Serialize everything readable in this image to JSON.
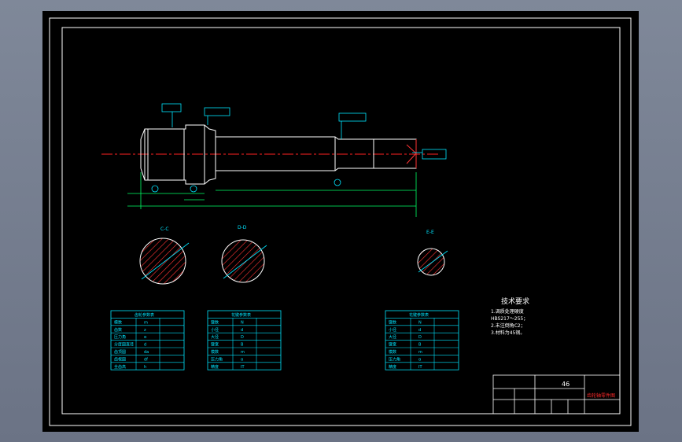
{
  "drawing": {
    "section_labels": [
      "C-C",
      "D-D",
      "E-E"
    ],
    "tech_requirements": {
      "title": "技术要求",
      "items": [
        "1.调质处理硬度",
        "HBS217～255；",
        "2.未注倒角C2；",
        "3.材料为45钢。"
      ]
    },
    "title_block": {
      "scale_value": "46",
      "drawing_title": "齿轮轴零件图"
    },
    "tables": [
      {
        "header": "齿轮参数表",
        "rows": [
          [
            "模数",
            "m"
          ],
          [
            "齿数",
            "z"
          ],
          [
            "压力角",
            "α"
          ],
          [
            "分度圆直径",
            "d"
          ],
          [
            "齿顶圆",
            "da"
          ],
          [
            "齿根圆",
            "df"
          ],
          [
            "全齿高",
            "h"
          ]
        ]
      },
      {
        "header": "花键参数表",
        "rows": [
          [
            "键数",
            "N"
          ],
          [
            "小径",
            "d"
          ],
          [
            "大径",
            "D"
          ],
          [
            "键宽",
            "B"
          ],
          [
            "模数",
            "m"
          ],
          [
            "压力角",
            "α"
          ],
          [
            "精度",
            "IT"
          ]
        ]
      },
      {
        "header": "花键参数表",
        "rows": [
          [
            "键数",
            "N"
          ],
          [
            "小径",
            "d"
          ],
          [
            "大径",
            "D"
          ],
          [
            "键宽",
            "B"
          ],
          [
            "模数",
            "m"
          ],
          [
            "压力角",
            "α"
          ],
          [
            "精度",
            "IT"
          ]
        ]
      }
    ]
  }
}
